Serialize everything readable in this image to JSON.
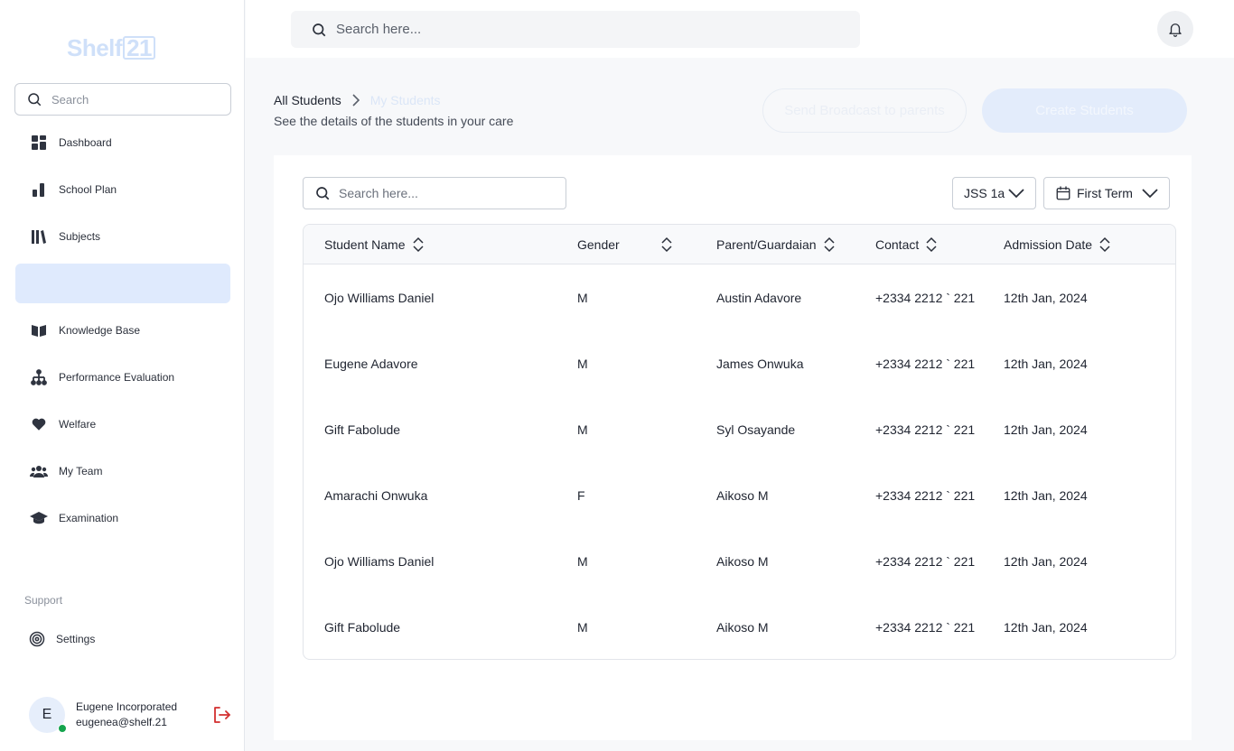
{
  "sidebar": {
    "logo_text": "Shelf",
    "logo_boxed": "21",
    "search_placeholder": "Search",
    "items": [
      {
        "label": "Dashboard",
        "icon": "grid-icon"
      },
      {
        "label": "School Plan",
        "icon": "bar-chart-icon"
      },
      {
        "label": "Subjects",
        "icon": "books-icon"
      },
      {
        "label": "",
        "icon": "",
        "active": true
      },
      {
        "label": "Knowledge Base",
        "icon": "open-book-icon"
      },
      {
        "label": "Performance Evaluation",
        "icon": "hierarchy-icon"
      },
      {
        "label": "Welfare",
        "icon": "heart-icon"
      },
      {
        "label": "My Team",
        "icon": "team-icon"
      },
      {
        "label": "Examination",
        "icon": "graduation-cap-icon"
      }
    ],
    "support_label": "Support",
    "settings_label": "Settings",
    "profile": {
      "initial": "E",
      "name": "Eugene Incorporated",
      "email": "eugenea@shelf.21",
      "status_color": "#14a44d"
    }
  },
  "topbar": {
    "search_placeholder": "Search here..."
  },
  "header": {
    "breadcrumb_root": "All Students",
    "breadcrumb_current": "My Students",
    "subtitle": "See the details of the students in your care",
    "broadcast_button": "Send Broadcast to parents",
    "create_button": "Create Students"
  },
  "filters": {
    "search_placeholder": "Search here...",
    "class_selected": "JSS 1a",
    "term_selected": "First Term"
  },
  "table": {
    "columns": [
      "Student Name",
      "Gender",
      "Parent/Guardaian",
      "Contact",
      "Admission Date"
    ],
    "rows": [
      {
        "name": "Ojo Williams Daniel",
        "gender": "M",
        "parent": "Austin Adavore",
        "contact": "+2334 2212 ` 221",
        "date": "12th Jan, 2024"
      },
      {
        "name": "Eugene Adavore",
        "gender": "M",
        "parent": "James Onwuka",
        "contact": "+2334 2212 ` 221",
        "date": "12th Jan, 2024"
      },
      {
        "name": "Gift Fabolude",
        "gender": "M",
        "parent": "Syl Osayande",
        "contact": "+2334 2212 ` 221",
        "date": "12th Jan, 2024"
      },
      {
        "name": "Amarachi Onwuka",
        "gender": "F",
        "parent": "Aikoso M",
        "contact": "+2334 2212 ` 221",
        "date": "12th Jan, 2024"
      },
      {
        "name": "Ojo Williams Daniel",
        "gender": "M",
        "parent": "Aikoso M",
        "contact": "+2334 2212 ` 221",
        "date": "12th Jan, 2024"
      },
      {
        "name": "Gift Fabolude",
        "gender": "M",
        "parent": "Aikoso M",
        "contact": "+2334 2212 ` 221",
        "date": "12th Jan, 2024"
      }
    ]
  },
  "colors": {
    "accent_light": "#dfeafd",
    "logout_red": "#d32f2f"
  }
}
